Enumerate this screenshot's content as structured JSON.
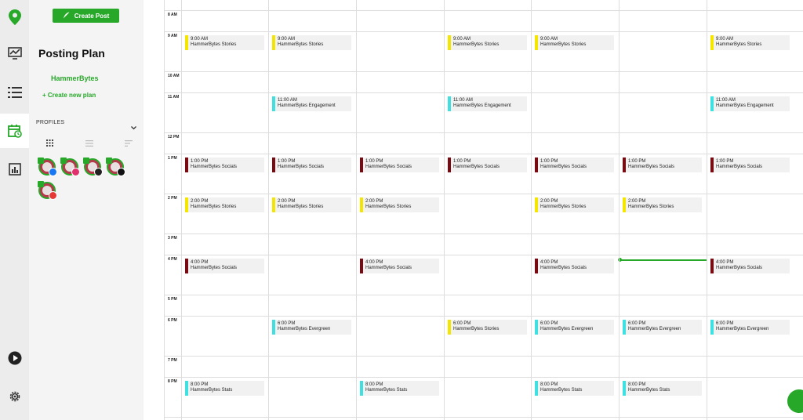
{
  "colors": {
    "brand": "#27a829",
    "stories": "#f5e600",
    "engagement": "#3fe0e0",
    "socials": "#7a0a12",
    "evergreen": "#3fe0e0",
    "stats": "#3fe0e0"
  },
  "sidebar": {
    "create_post": "Create Post",
    "title": "Posting Plan",
    "plan_name": "HammerBytes",
    "create_new_plan": "+ Create new plan",
    "profiles_header": "PROFILES",
    "profiles": [
      {
        "network": "facebook",
        "color": "#1877f2"
      },
      {
        "network": "instagram",
        "color": "#e1306c"
      },
      {
        "network": "threads",
        "color": "#222222"
      },
      {
        "network": "x",
        "color": "#111111"
      },
      {
        "network": "youtube",
        "color": "#e53935"
      }
    ]
  },
  "calendar": {
    "hours": [
      "8 AM",
      "9 AM",
      "10 AM",
      "11 AM",
      "12 PM",
      "1 PM",
      "2 PM",
      "3 PM",
      "4 PM",
      "5 PM",
      "6 PM",
      "7 PM",
      "8 PM"
    ],
    "events": [
      {
        "day": 0,
        "hour": 1,
        "time": "9:00 AM",
        "name": "HammerBytes Stories",
        "kind": "stories"
      },
      {
        "day": 1,
        "hour": 1,
        "time": "9:00 AM",
        "name": "HammerBytes Stories",
        "kind": "stories"
      },
      {
        "day": 3,
        "hour": 1,
        "time": "9:00 AM",
        "name": "HammerBytes Stories",
        "kind": "stories"
      },
      {
        "day": 4,
        "hour": 1,
        "time": "9:00 AM",
        "name": "HammerBytes Stories",
        "kind": "stories"
      },
      {
        "day": 6,
        "hour": 1,
        "time": "9:00 AM",
        "name": "HammerBytes Stories",
        "kind": "stories"
      },
      {
        "day": 1,
        "hour": 3,
        "time": "11:00 AM",
        "name": "HammerBytes Engagement",
        "kind": "engagement"
      },
      {
        "day": 3,
        "hour": 3,
        "time": "11:00 AM",
        "name": "HammerBytes Engagement",
        "kind": "engagement"
      },
      {
        "day": 6,
        "hour": 3,
        "time": "11:00 AM",
        "name": "HammerBytes Engagement",
        "kind": "engagement"
      },
      {
        "day": 0,
        "hour": 5,
        "time": "1:00 PM",
        "name": "HammerBytes Socials",
        "kind": "socials"
      },
      {
        "day": 1,
        "hour": 5,
        "time": "1:00 PM",
        "name": "HammerBytes Socials",
        "kind": "socials"
      },
      {
        "day": 2,
        "hour": 5,
        "time": "1:00 PM",
        "name": "HammerBytes Socials",
        "kind": "socials"
      },
      {
        "day": 3,
        "hour": 5,
        "time": "1:00 PM",
        "name": "HammerBytes Socials",
        "kind": "socials"
      },
      {
        "day": 4,
        "hour": 5,
        "time": "1:00 PM",
        "name": "HammerBytes Socials",
        "kind": "socials"
      },
      {
        "day": 5,
        "hour": 5,
        "time": "1:00 PM",
        "name": "HammerBytes Socials",
        "kind": "socials"
      },
      {
        "day": 6,
        "hour": 5,
        "time": "1:00 PM",
        "name": "HammerBytes Socials",
        "kind": "socials"
      },
      {
        "day": 0,
        "hour": 6,
        "time": "2:00 PM",
        "name": "HammerBytes Stories",
        "kind": "stories"
      },
      {
        "day": 1,
        "hour": 6,
        "time": "2:00 PM",
        "name": "HammerBytes Stories",
        "kind": "stories"
      },
      {
        "day": 2,
        "hour": 6,
        "time": "2:00 PM",
        "name": "HammerBytes Stories",
        "kind": "stories"
      },
      {
        "day": 4,
        "hour": 6,
        "time": "2:00 PM",
        "name": "HammerBytes Stories",
        "kind": "stories"
      },
      {
        "day": 5,
        "hour": 6,
        "time": "2:00 PM",
        "name": "HammerBytes Stories",
        "kind": "stories"
      },
      {
        "day": 0,
        "hour": 8,
        "time": "4:00 PM",
        "name": "HammerBytes Socials",
        "kind": "socials"
      },
      {
        "day": 2,
        "hour": 8,
        "time": "4:00 PM",
        "name": "HammerBytes Socials",
        "kind": "socials"
      },
      {
        "day": 4,
        "hour": 8,
        "time": "4:00 PM",
        "name": "HammerBytes Socials",
        "kind": "socials"
      },
      {
        "day": 6,
        "hour": 8,
        "time": "4:00 PM",
        "name": "HammerBytes Socials",
        "kind": "socials"
      },
      {
        "day": 1,
        "hour": 10,
        "time": "6:00 PM",
        "name": "HammerBytes Evergreen",
        "kind": "evergreen"
      },
      {
        "day": 3,
        "hour": 10,
        "time": "6:00 PM",
        "name": "HammerBytes Stories",
        "kind": "stories"
      },
      {
        "day": 4,
        "hour": 10,
        "time": "6:00 PM",
        "name": "HammerBytes Evergreen",
        "kind": "evergreen"
      },
      {
        "day": 5,
        "hour": 10,
        "time": "6:00 PM",
        "name": "HammerBytes Evergreen",
        "kind": "evergreen"
      },
      {
        "day": 6,
        "hour": 10,
        "time": "6:00 PM",
        "name": "HammerBytes Evergreen",
        "kind": "evergreen"
      },
      {
        "day": 0,
        "hour": 12,
        "time": "8:00 PM",
        "name": "HammerBytes Stats",
        "kind": "stats"
      },
      {
        "day": 2,
        "hour": 12,
        "time": "8:00 PM",
        "name": "HammerBytes Stats",
        "kind": "stats"
      },
      {
        "day": 4,
        "hour": 12,
        "time": "8:00 PM",
        "name": "HammerBytes Stats",
        "kind": "stats"
      },
      {
        "day": 5,
        "hour": 12,
        "time": "8:00 PM",
        "name": "HammerBytes Stats",
        "kind": "stats"
      }
    ]
  }
}
